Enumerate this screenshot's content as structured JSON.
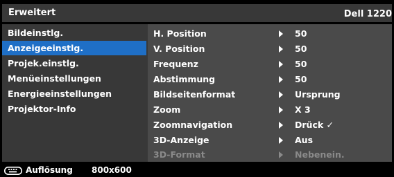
{
  "title": {
    "left": "Erweitert",
    "right": "Dell 1220"
  },
  "menu": {
    "items": [
      {
        "label": "Bildeinstlg."
      },
      {
        "label": "Anzeigeeinstlg."
      },
      {
        "label": "Projek.einstlg."
      },
      {
        "label": "Menüeinstellungen"
      },
      {
        "label": "Energieeinstellungen"
      },
      {
        "label": "Projektor-Info"
      }
    ],
    "selected": "Anzeigeeinstlg."
  },
  "settings": {
    "rows": [
      {
        "label": "H. Position",
        "value": "50"
      },
      {
        "label": "V. Position",
        "value": "50"
      },
      {
        "label": "Frequenz",
        "value": "50"
      },
      {
        "label": "Abstimmung",
        "value": "50"
      },
      {
        "label": "Bildseitenformat",
        "value": "Ursprung"
      },
      {
        "label": "Zoom",
        "value": "X 3"
      },
      {
        "label": "Zoomnavigation",
        "value": "Drück ✓"
      },
      {
        "label": "3D-Anzeige",
        "value": "Aus"
      },
      {
        "label": "3D-Format",
        "value": "Nebenein.",
        "disabled": true
      }
    ]
  },
  "status": {
    "icon": "keyboard-icon",
    "label": "Auflösung",
    "value": "800x600"
  },
  "colors": {
    "background": "#000000",
    "panel": "#383838",
    "detail_panel": "#4a4a4a",
    "selected": "#1f6fc6",
    "disabled": "#8a8a8a"
  }
}
